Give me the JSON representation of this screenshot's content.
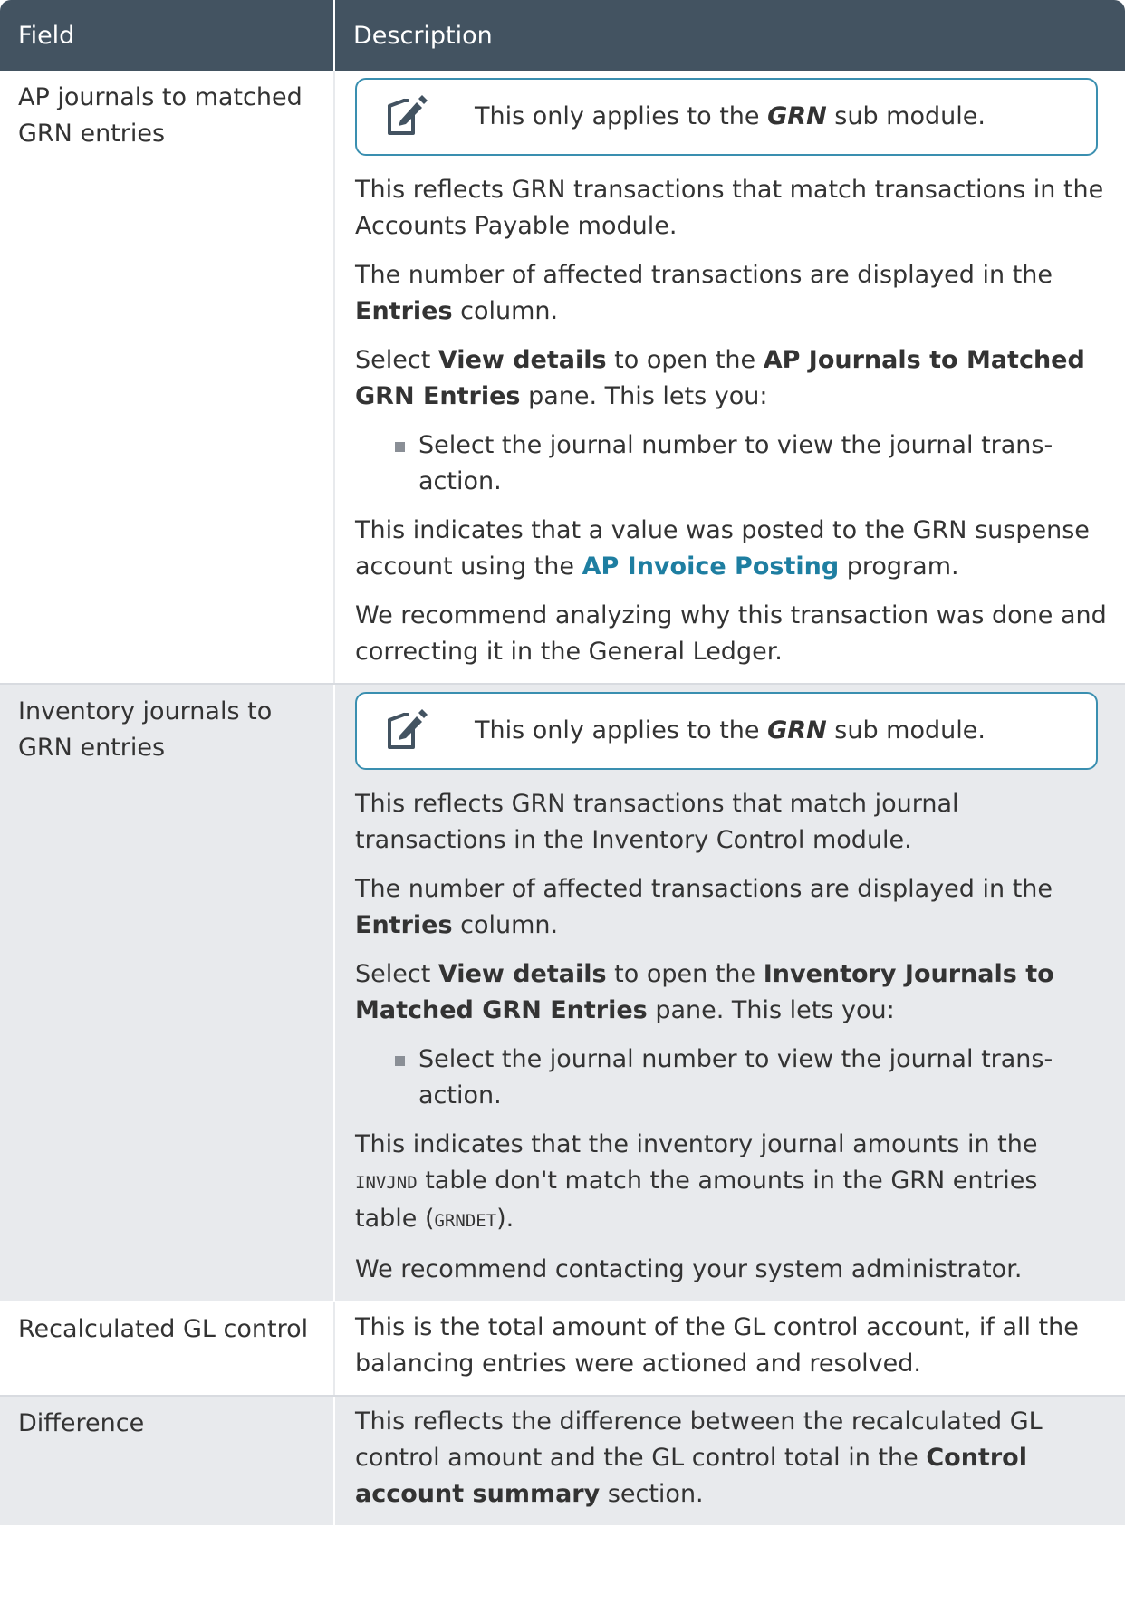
{
  "header": {
    "field": "Field",
    "description": "Description"
  },
  "rows": [
    {
      "field": "AP journals to matched GRN entries",
      "note": {
        "pre": "This only applies to the ",
        "bold": "GRN",
        "post": " sub module."
      },
      "p1": "This reflects GRN transactions that match transactions in the Accounts Payable module.",
      "p2_pre": "The number of affected transactions are displayed in the ",
      "p2_bold": "Entries",
      "p2_post": " column.",
      "p3_pre": "Select ",
      "p3_b1": "View details",
      "p3_mid": " to open the ",
      "p3_b2": "AP Journals to Matched GRN Entries",
      "p3_post": " pane. This lets you:",
      "bullet": "Select the journal number to view the journal trans-action.",
      "p4_pre": "This indicates that a value was posted to the GRN suspense account using the ",
      "p4_link": "AP Invoice Posting",
      "p4_post": " program.",
      "p5": "We recommend analyzing why this transaction was done and correcting it in the General Ledger."
    },
    {
      "field": "Inventory journals to GRN entries",
      "note": {
        "pre": "This only applies to the ",
        "bold": "GRN",
        "post": " sub module."
      },
      "p1": "This reflects GRN transactions that match journal transactions in the Inventory Control module.",
      "p2_pre": "The number of affected transactions are displayed in the ",
      "p2_bold": "Entries",
      "p2_post": " column.",
      "p3_pre": "Select ",
      "p3_b1": "View details",
      "p3_mid": " to open the ",
      "p3_b2": "Inventory Journals to Matched GRN Entries",
      "p3_post": " pane. This lets you:",
      "bullet": "Select the journal number to view the journal trans-action.",
      "p4_pre": "This indicates that the inventory journal amounts in the ",
      "p4_code1": "INVJND",
      "p4_mid": " table don't match the amounts in the GRN entries table (",
      "p4_code2": "GRNDET",
      "p4_post": ").",
      "p5": "We recommend contacting your system administrator."
    },
    {
      "field": "Recalculated GL control",
      "p1": "This is the total amount of the GL control account, if all the balancing entries were actioned and resolved."
    },
    {
      "field": "Difference",
      "p1_pre": "This reflects the difference between the recalculated GL control amount and the GL control total in the ",
      "p1_bold": "Control account summary",
      "p1_post": " section."
    }
  ],
  "icons": {
    "note": "note-edit-icon"
  },
  "colors": {
    "header_bg": "#435361",
    "link": "#1e7ea1",
    "note_border": "#3a8fb0",
    "row_alt": "#e8eaed"
  }
}
